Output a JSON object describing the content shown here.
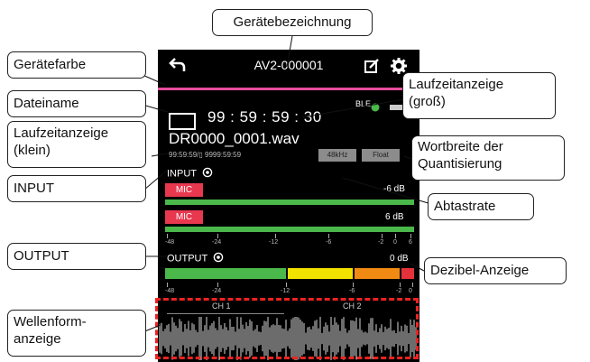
{
  "device": {
    "name": "AV2-000001",
    "ble_label": "BLE",
    "big_time": "99 : 59 : 59 : 30",
    "file_name": "DR0000_0001.wav",
    "small_time": "99:59:59/▯ 9999:59:59",
    "sample_rate": "48kHz",
    "bit_depth": "Float",
    "accent_color": "#e94d9e"
  },
  "input": {
    "title": "INPUT",
    "channels": [
      {
        "label": "MIC",
        "db": "-6 dB",
        "level": 1.0
      },
      {
        "label": "MIC",
        "db": "6 dB",
        "level": 1.0
      }
    ],
    "scale": [
      "-48",
      "-24",
      "-12",
      "-6",
      "-2",
      "0",
      "6"
    ]
  },
  "output": {
    "title": "OUTPUT",
    "db": "0 dB",
    "scale": [
      "-48",
      "-24",
      "-12",
      "-6",
      "-2",
      "0"
    ]
  },
  "waveform": {
    "ch1": "CH 1",
    "ch2": "CH 2"
  },
  "callouts": {
    "geraetebezeichnung": "Gerätebezeichnung",
    "geraetefarbe": "Gerätefarbe",
    "dateiname": "Dateiname",
    "laufzeit_klein": "Laufzeitanzeige\n(klein)",
    "input": "INPUT",
    "output": "OUTPUT",
    "wellenform": "Wellenform-\nanzeige",
    "laufzeit_gross": "Laufzeitanzeige\n(groß)",
    "wortbreite": "Wortbreite der\nQuantisierung",
    "abtastrate": "Abtastrate",
    "dezibel": "Dezibel-Anzeige"
  }
}
